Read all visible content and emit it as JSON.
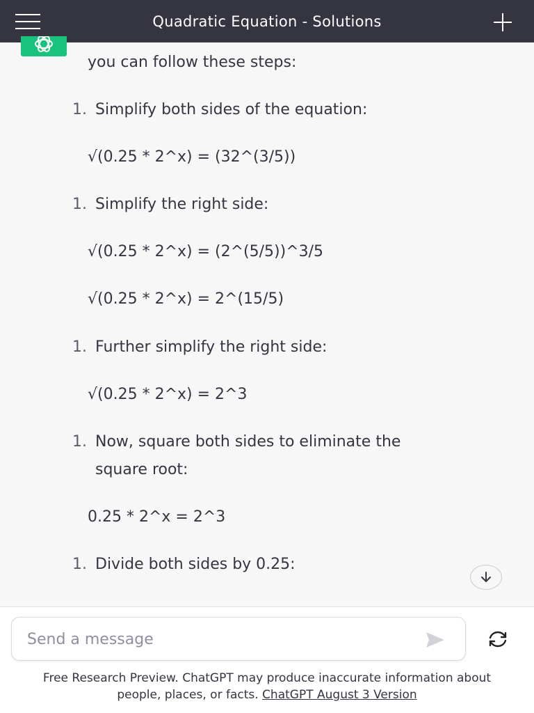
{
  "header": {
    "title": "Quadratic Equation - Solutions",
    "menu_icon": "hamburger-icon",
    "new_chat_icon": "plus-icon"
  },
  "assistant_avatar": {
    "icon": "chatgpt-logo-icon",
    "color": "#19c37d"
  },
  "message": {
    "intro": "you can follow these steps:",
    "steps": [
      {
        "number": "1.",
        "text": "Simplify both sides of the equation:"
      },
      {
        "number": "1.",
        "text": "Simplify the right side:"
      },
      {
        "number": "1.",
        "text": "Further simplify the right side:"
      },
      {
        "number": "1.",
        "text": "Now, square both sides to eliminate the",
        "text2": "square root:"
      },
      {
        "number": "1.",
        "text": "Divide both sides by 0.25:"
      }
    ],
    "equations": [
      "√(0.25 * 2^x) = (32^(3/5))",
      "√(0.25 * 2^x) = (2^(5/5))^3/5",
      "√(0.25 * 2^x) = 2^(15/5)",
      "√(0.25 * 2^x) = 2^3",
      "0.25 * 2^x = 2^3"
    ]
  },
  "composer": {
    "placeholder": "Send a message",
    "send_icon": "send-icon",
    "regenerate_icon": "regenerate-icon"
  },
  "footer": {
    "disclaimer_line1": "Free Research Preview. ChatGPT may produce inaccurate information about",
    "disclaimer_line2": "people, places, or facts. ",
    "version_link": "ChatGPT August 3 Version"
  },
  "colors": {
    "header_bg": "#343541",
    "page_bg": "#f7f7f8",
    "accent": "#19c37d"
  }
}
